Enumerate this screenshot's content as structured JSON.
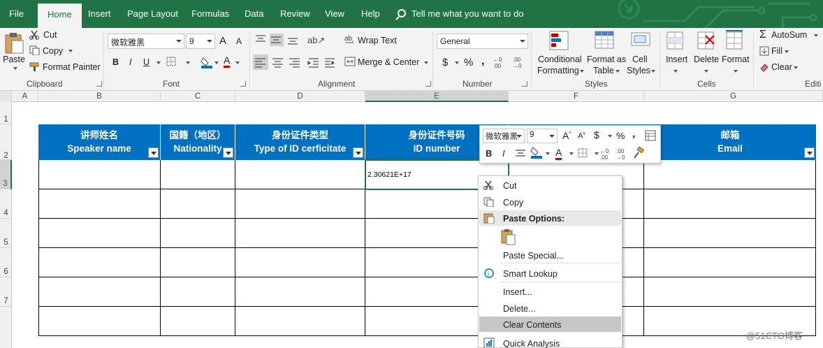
{
  "ribbon_tabs": [
    "File",
    "Home",
    "Insert",
    "Page Layout",
    "Formulas",
    "Data",
    "Review",
    "View",
    "Help"
  ],
  "tell_me": "Tell me what you want to do",
  "clipboard": {
    "paste": "Paste",
    "cut": "Cut",
    "copy": "Copy",
    "format_painter": "Format Painter",
    "label": "Clipboard"
  },
  "font": {
    "name": "微软雅黑",
    "size": "9",
    "label": "Font",
    "bold": "B",
    "italic": "I",
    "underline": "U",
    "grow": "A",
    "shrink": "A",
    "font_color_letter": "A"
  },
  "alignment": {
    "wrap": "Wrap Text",
    "merge": "Merge & Center",
    "label": "Alignment"
  },
  "number": {
    "format": "General",
    "label": "Number",
    "currency": "$",
    "percent": "%",
    "comma": ","
  },
  "styles": {
    "conditional": "Conditional",
    "conditional2": "Formatting",
    "format_as": "Format as",
    "format_as2": "Table",
    "cell": "Cell",
    "cell2": "Styles",
    "label": "Styles"
  },
  "cells": {
    "insert": "Insert",
    "delete": "Delete",
    "format": "Format",
    "label": "Cells"
  },
  "editing": {
    "autosum": "AutoSum",
    "fill": "Fill",
    "clear": "Clear",
    "label": "Editi"
  },
  "columns": [
    "A",
    "B",
    "C",
    "D",
    "E",
    "F",
    "G"
  ],
  "rows": [
    "1",
    "2",
    "3",
    "4",
    "5",
    "6",
    "7"
  ],
  "headers": [
    {
      "cn": "讲师姓名",
      "en": "Speaker name"
    },
    {
      "cn": "国籍（地区）",
      "en": "Nationality"
    },
    {
      "cn": "身份证件类型",
      "en": "Type of ID cerficitate"
    },
    {
      "cn": "身份证件号码",
      "en": "ID number"
    },
    {
      "cn": "",
      "en": ""
    },
    {
      "cn": "邮箱",
      "en": "Email"
    }
  ],
  "active_cell_value": "2.30621E+17",
  "mini_toolbar": {
    "font": "微软雅黑",
    "size": "9",
    "currency": "$",
    "percent": "%",
    "comma": ",",
    "bold": "B",
    "italic": "I",
    "font_color_letter": "A"
  },
  "context_menu": {
    "cut": "Cut",
    "copy": "Copy",
    "paste_options": "Paste Options:",
    "paste_special": "Paste Special...",
    "smart_lookup": "Smart Lookup",
    "insert": "Insert...",
    "delete": "Delete...",
    "clear_contents": "Clear Contents",
    "quick_analysis": "Quick Analysis"
  },
  "watermark": "@51CTO博客",
  "colors": {
    "excel_green": "#217346",
    "header_blue": "#0070c0",
    "ribbon_bg": "#f3f3f3"
  }
}
